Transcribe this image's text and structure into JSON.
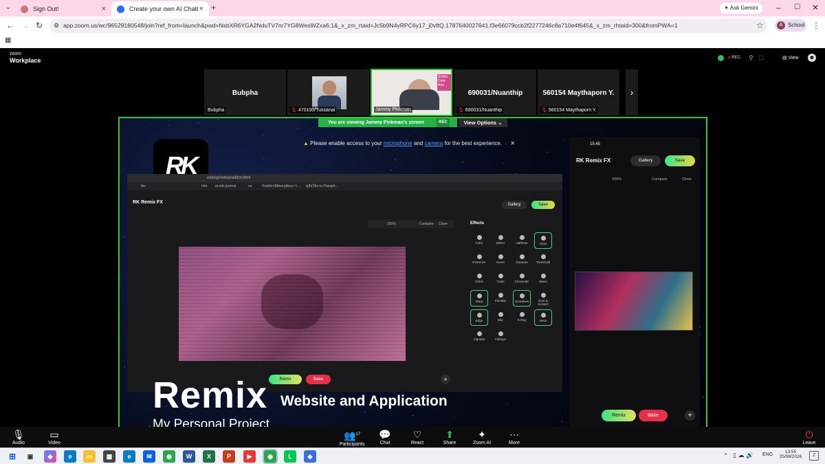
{
  "browser": {
    "tabs": [
      {
        "title": "Sign Out!",
        "active": false
      },
      {
        "title": "Create your own AI Chatbo",
        "active": true
      }
    ],
    "ask_gemini": "Ask Gemini",
    "url": "app.zoom.us/wc/96529180548/join?ref_from=launch&pwd=NsbXR6YGA2NduTV7nr7YG8WesWZxa6.1&_x_zm_rtaid=Jc5b9N4yRPC6y17_j0vftQ.1787640027641.f3e66079ccb2f2277246c8a710e4f645&_x_zm_rhtaid=300&fromPWA=1",
    "profile": "School",
    "profile_initial": "A"
  },
  "zoom": {
    "logo_top": "zoom",
    "logo_bottom": "Workplace",
    "rec": "REC",
    "view": "View",
    "participants": [
      {
        "name": "Bubpha",
        "label": "Bubpha",
        "video": false,
        "muted": false
      },
      {
        "name": "",
        "label": "470100/Tussanai",
        "video": true,
        "muted": true
      },
      {
        "name": "",
        "label": "Jammy Pinkman",
        "video": true,
        "muted": false
      },
      {
        "name": "690031/Nuanthip",
        "label": "690031/Nuanthip",
        "video": false,
        "muted": true
      },
      {
        "name": "560154 Maythaporn Y.",
        "label": "560154 Maythaporn Y.",
        "video": false,
        "muted": true
      }
    ],
    "viewing_banner": "You are viewing  Jammy Pinkman's screen",
    "viewing_rec": "REC",
    "view_options": "View Options",
    "notice_text": "Please enable access to your",
    "notice_mic": "microphone",
    "notice_and": "and",
    "notice_camera": "camera",
    "notice_tail": "for the best experience.",
    "toolbar": {
      "audio": "Audio",
      "video": "Video",
      "participants": "Participants",
      "participants_count": "17",
      "chat": "Chat",
      "react": "React",
      "share": "Share",
      "zoom_ai": "Zoom AI",
      "more": "More",
      "leave": "Leave"
    }
  },
  "shared": {
    "inner_url": "esktop/remix/editor.html",
    "bookmarks": [
      "fav",
      "ctor",
      "ai edu journal",
      "ca",
      "รับสมัครนิสิตครูพัฒนาฯ ...",
      "คู่มือใช้งาน Pasaph..."
    ],
    "app_name": "Remix FX",
    "gallery": "Gallery",
    "save": "Save",
    "zoom_level": "100%",
    "compare": "Compare",
    "close": "Close",
    "effects_title": "Effects",
    "effects": [
      "Color",
      "Dither",
      "Halftone",
      "Glow",
      "Posterize",
      "Invert",
      "Duotone",
      "Threshold",
      "Glitch",
      "Grain",
      "Chromatic",
      "Wave",
      "Warp",
      "Pixelate",
      "Scanlines",
      "Dust & Scratch",
      "Edge",
      "Blur",
      "X-Ray",
      "Neon",
      "Vignette",
      "Fisheye"
    ],
    "remix": "Remix",
    "bake": "Bake",
    "phone_time": "15:45",
    "overlay_title": "Remix",
    "overlay_subtitle": "Website and Application",
    "overlay_caption": "My Personal Project"
  },
  "taskbar": {
    "lang": "ENG",
    "time": "13:55",
    "date": "25/08/2026",
    "notif": "2"
  },
  "colors": {
    "accent_green": "#32c832",
    "rec_red": "#e53935",
    "tab_pink": "#fcd7ea",
    "remix_gradient_start": "#3be38a",
    "bake_red": "#e5304a"
  }
}
